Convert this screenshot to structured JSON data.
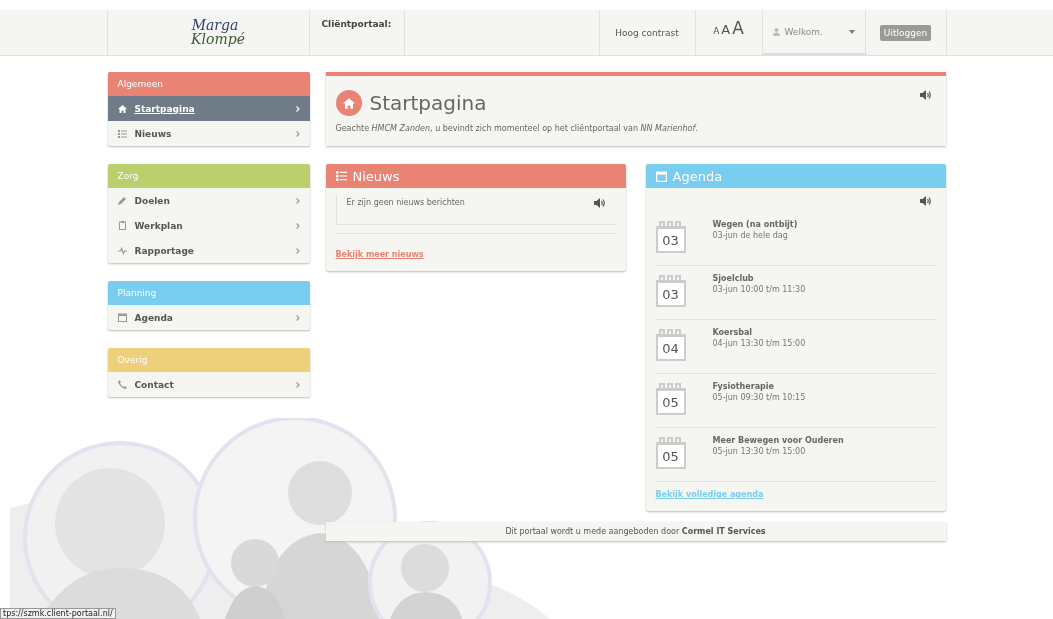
{
  "header": {
    "logo": {
      "line_1": "Marga",
      "line_2": "Klompé"
    },
    "portal_label": "Cliëntportaal:",
    "contrast": "Hoog contrast",
    "font_sizes": [
      "A",
      "A",
      "A"
    ],
    "user": "Welkom.",
    "logout": "Uitloggen"
  },
  "sidebar": {
    "groups": [
      {
        "title": "Algemeen",
        "color": "#e98373",
        "items": [
          {
            "label": "Startpagina",
            "kind": "home",
            "selected": true
          },
          {
            "label": "Nieuws",
            "kind": "list",
            "selected": false
          }
        ]
      },
      {
        "title": "Zorg",
        "color": "#bccf6d",
        "items": [
          {
            "label": "Doelen",
            "kind": "pencil",
            "selected": false
          },
          {
            "label": "Werkplan",
            "kind": "clipboard",
            "selected": false
          },
          {
            "label": "Rapportage",
            "kind": "pulse",
            "selected": false
          }
        ]
      },
      {
        "title": "Planning",
        "color": "#79cdee",
        "items": [
          {
            "label": "Agenda",
            "kind": "calendar",
            "selected": false
          }
        ]
      },
      {
        "title": "Overig",
        "color": "#efd07a",
        "items": [
          {
            "label": "Contact",
            "kind": "phone",
            "selected": false
          }
        ]
      }
    ]
  },
  "page": {
    "title": "Startpagina",
    "greeting": "Geachte *HMCM Zanden*, u bevindt zich momenteel op het cliëntportaal van *NN Marienhof*."
  },
  "news": {
    "title": "Nieuws",
    "message": "Er zijn geen nieuws berichten",
    "link": "Bekijk meer nieuws"
  },
  "agenda": {
    "title": "Agenda",
    "events": [
      {
        "day": "03",
        "title": "Wegen (na ontbijt)",
        "when": "03-jun de hele dag"
      },
      {
        "day": "03",
        "title": "Sjoelclub",
        "when": "03-jun 10:00 t/m 11:30"
      },
      {
        "day": "04",
        "title": "Koersbal",
        "when": "04-jun 13:30 t/m 15:00"
      },
      {
        "day": "05",
        "title": "Fysiotherapie",
        "when": "05-jun 09:30 t/m 10:15"
      },
      {
        "day": "05",
        "title": "Meer Bewegen voor Ouderen",
        "when": "05-jun 13:30 t/m 15:00"
      }
    ],
    "link": "Bekijk volledige agenda"
  },
  "footer": "Dit portaal wordt u mede aangeboden door **Cormel IT Services**",
  "status_url": "tps://szmk.client-portaal.nl/"
}
